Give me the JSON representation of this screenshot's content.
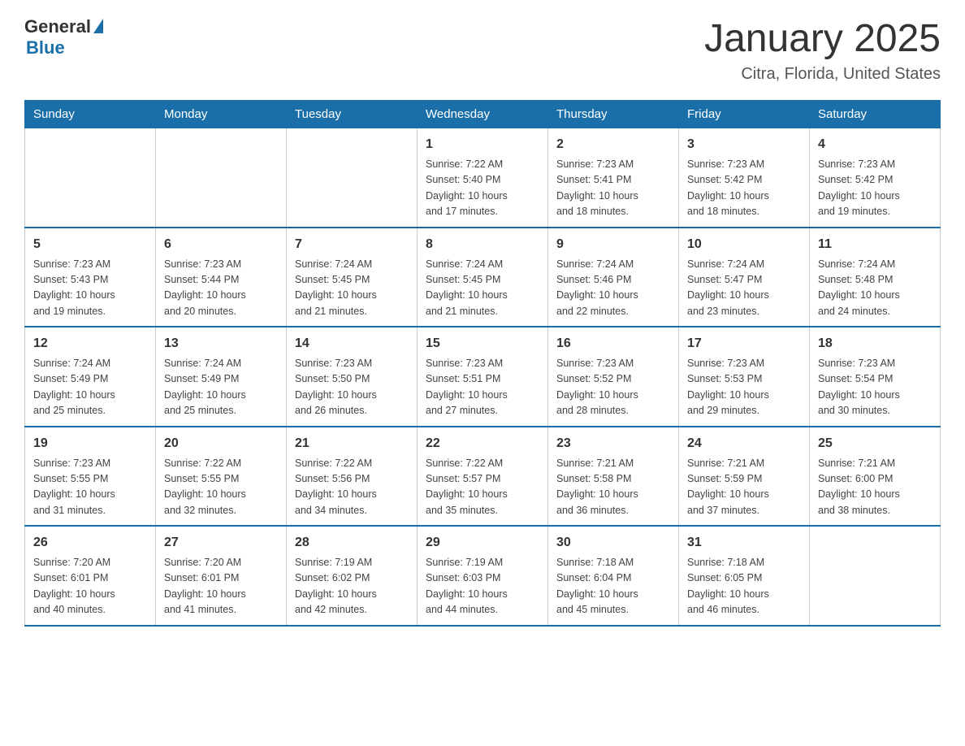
{
  "header": {
    "logo_general": "General",
    "logo_blue": "Blue",
    "title": "January 2025",
    "subtitle": "Citra, Florida, United States"
  },
  "days_of_week": [
    "Sunday",
    "Monday",
    "Tuesday",
    "Wednesday",
    "Thursday",
    "Friday",
    "Saturday"
  ],
  "weeks": [
    [
      {
        "day": "",
        "info": ""
      },
      {
        "day": "",
        "info": ""
      },
      {
        "day": "",
        "info": ""
      },
      {
        "day": "1",
        "info": "Sunrise: 7:22 AM\nSunset: 5:40 PM\nDaylight: 10 hours\nand 17 minutes."
      },
      {
        "day": "2",
        "info": "Sunrise: 7:23 AM\nSunset: 5:41 PM\nDaylight: 10 hours\nand 18 minutes."
      },
      {
        "day": "3",
        "info": "Sunrise: 7:23 AM\nSunset: 5:42 PM\nDaylight: 10 hours\nand 18 minutes."
      },
      {
        "day": "4",
        "info": "Sunrise: 7:23 AM\nSunset: 5:42 PM\nDaylight: 10 hours\nand 19 minutes."
      }
    ],
    [
      {
        "day": "5",
        "info": "Sunrise: 7:23 AM\nSunset: 5:43 PM\nDaylight: 10 hours\nand 19 minutes."
      },
      {
        "day": "6",
        "info": "Sunrise: 7:23 AM\nSunset: 5:44 PM\nDaylight: 10 hours\nand 20 minutes."
      },
      {
        "day": "7",
        "info": "Sunrise: 7:24 AM\nSunset: 5:45 PM\nDaylight: 10 hours\nand 21 minutes."
      },
      {
        "day": "8",
        "info": "Sunrise: 7:24 AM\nSunset: 5:45 PM\nDaylight: 10 hours\nand 21 minutes."
      },
      {
        "day": "9",
        "info": "Sunrise: 7:24 AM\nSunset: 5:46 PM\nDaylight: 10 hours\nand 22 minutes."
      },
      {
        "day": "10",
        "info": "Sunrise: 7:24 AM\nSunset: 5:47 PM\nDaylight: 10 hours\nand 23 minutes."
      },
      {
        "day": "11",
        "info": "Sunrise: 7:24 AM\nSunset: 5:48 PM\nDaylight: 10 hours\nand 24 minutes."
      }
    ],
    [
      {
        "day": "12",
        "info": "Sunrise: 7:24 AM\nSunset: 5:49 PM\nDaylight: 10 hours\nand 25 minutes."
      },
      {
        "day": "13",
        "info": "Sunrise: 7:24 AM\nSunset: 5:49 PM\nDaylight: 10 hours\nand 25 minutes."
      },
      {
        "day": "14",
        "info": "Sunrise: 7:23 AM\nSunset: 5:50 PM\nDaylight: 10 hours\nand 26 minutes."
      },
      {
        "day": "15",
        "info": "Sunrise: 7:23 AM\nSunset: 5:51 PM\nDaylight: 10 hours\nand 27 minutes."
      },
      {
        "day": "16",
        "info": "Sunrise: 7:23 AM\nSunset: 5:52 PM\nDaylight: 10 hours\nand 28 minutes."
      },
      {
        "day": "17",
        "info": "Sunrise: 7:23 AM\nSunset: 5:53 PM\nDaylight: 10 hours\nand 29 minutes."
      },
      {
        "day": "18",
        "info": "Sunrise: 7:23 AM\nSunset: 5:54 PM\nDaylight: 10 hours\nand 30 minutes."
      }
    ],
    [
      {
        "day": "19",
        "info": "Sunrise: 7:23 AM\nSunset: 5:55 PM\nDaylight: 10 hours\nand 31 minutes."
      },
      {
        "day": "20",
        "info": "Sunrise: 7:22 AM\nSunset: 5:55 PM\nDaylight: 10 hours\nand 32 minutes."
      },
      {
        "day": "21",
        "info": "Sunrise: 7:22 AM\nSunset: 5:56 PM\nDaylight: 10 hours\nand 34 minutes."
      },
      {
        "day": "22",
        "info": "Sunrise: 7:22 AM\nSunset: 5:57 PM\nDaylight: 10 hours\nand 35 minutes."
      },
      {
        "day": "23",
        "info": "Sunrise: 7:21 AM\nSunset: 5:58 PM\nDaylight: 10 hours\nand 36 minutes."
      },
      {
        "day": "24",
        "info": "Sunrise: 7:21 AM\nSunset: 5:59 PM\nDaylight: 10 hours\nand 37 minutes."
      },
      {
        "day": "25",
        "info": "Sunrise: 7:21 AM\nSunset: 6:00 PM\nDaylight: 10 hours\nand 38 minutes."
      }
    ],
    [
      {
        "day": "26",
        "info": "Sunrise: 7:20 AM\nSunset: 6:01 PM\nDaylight: 10 hours\nand 40 minutes."
      },
      {
        "day": "27",
        "info": "Sunrise: 7:20 AM\nSunset: 6:01 PM\nDaylight: 10 hours\nand 41 minutes."
      },
      {
        "day": "28",
        "info": "Sunrise: 7:19 AM\nSunset: 6:02 PM\nDaylight: 10 hours\nand 42 minutes."
      },
      {
        "day": "29",
        "info": "Sunrise: 7:19 AM\nSunset: 6:03 PM\nDaylight: 10 hours\nand 44 minutes."
      },
      {
        "day": "30",
        "info": "Sunrise: 7:18 AM\nSunset: 6:04 PM\nDaylight: 10 hours\nand 45 minutes."
      },
      {
        "day": "31",
        "info": "Sunrise: 7:18 AM\nSunset: 6:05 PM\nDaylight: 10 hours\nand 46 minutes."
      },
      {
        "day": "",
        "info": ""
      }
    ]
  ]
}
